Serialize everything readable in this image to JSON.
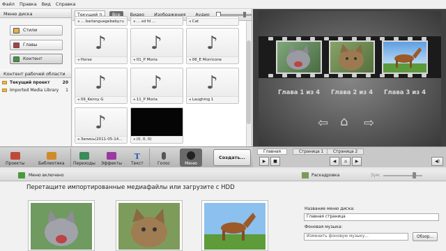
{
  "menubar": {
    "items": [
      "Файл",
      "Правка",
      "Вид",
      "Справка"
    ]
  },
  "left": {
    "title": "Меню диска",
    "buttons": [
      "Стили",
      "Главы",
      "Контент"
    ],
    "workspace_title": "Контент рабочей области",
    "tree": [
      {
        "label": "Текущий проект",
        "count": "20"
      },
      {
        "label": "Imported Media Library",
        "count": "1"
      }
    ]
  },
  "media": {
    "tabs": [
      "Текущий п...",
      "Все",
      "Видео",
      "Изображения",
      "Аудио"
    ],
    "top_partial": [
      "... barlanguagebaby.ru",
      "... sd fd ...",
      "Cat"
    ],
    "cells": [
      "Horse",
      "01_P Moria",
      "06_E Morricone",
      "09_Kenny G",
      "11_P Moria",
      "Laughing 1",
      "Запись(2011-05-14...",
      "(0, 0, 0)"
    ]
  },
  "preview": {
    "chapters": [
      "Глава 1 из 4",
      "Глава 2 из 4",
      "Глава 3 из 4"
    ],
    "nav": {
      "left": "⇦",
      "home": "⌂",
      "right": "⇨"
    }
  },
  "toolbar": {
    "buttons": [
      "Проекты",
      "Библиотека",
      "Переходы",
      "Эффекты",
      "Текст",
      "Голос",
      "Меню"
    ],
    "create": "Создать...",
    "colors": {
      "menu_active": "#6a6a6a",
      "preview_bg": "#404040",
      "film": "#1b1b1b"
    }
  },
  "pages": {
    "tabs": [
      "Главная",
      "Страница 1",
      "Страница 2"
    ]
  },
  "player": {
    "play": "▶",
    "stop": "■",
    "prev": "◀",
    "home": "⌂",
    "next": "▶",
    "volume": "◀)"
  },
  "bottom": {
    "status": "Меню включено",
    "layout": "Раскадровка",
    "zoom": "Зум:",
    "hint": "Перетащите импортированные медиафайлы или загрузите с HDD",
    "disc_name_label": "Название меню диска:",
    "disc_name_value": "Главная страница",
    "music_label": "Фоновая музыка:",
    "music_value": "Изменить фоновую музыку...",
    "browse": "Обзор..."
  }
}
